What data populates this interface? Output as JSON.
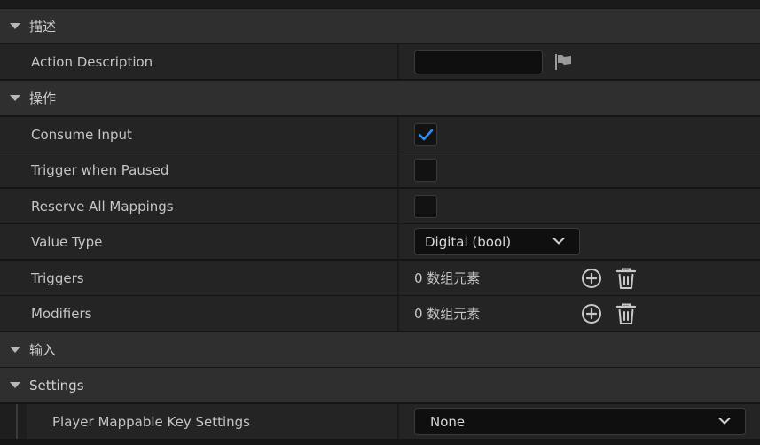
{
  "categories": {
    "description": "描述",
    "action": "操作",
    "input": "输入",
    "settings": "Settings"
  },
  "properties": {
    "action_description": {
      "label": "Action Description",
      "value": ""
    },
    "consume_input": {
      "label": "Consume Input",
      "checked": true
    },
    "trigger_when_paused": {
      "label": "Trigger when Paused",
      "checked": false
    },
    "reserve_all_mappings": {
      "label": "Reserve All Mappings",
      "checked": false
    },
    "value_type": {
      "label": "Value Type",
      "selected": "Digital (bool)"
    },
    "triggers": {
      "label": "Triggers",
      "count_text": "0 数组元素"
    },
    "modifiers": {
      "label": "Modifiers",
      "count_text": "0 数组元素"
    },
    "player_mappable_key_settings": {
      "label": "Player Mappable Key Settings",
      "selected": "None"
    }
  },
  "icons": {
    "category_toggle": "triangle-down-icon",
    "reset": "flag-icon",
    "checkbox_mark": "checkmark-icon",
    "dropdown": "chevron-down-icon",
    "add": "add-circle-icon",
    "clear": "trash-icon"
  },
  "colors": {
    "checkmark": "#2f8cf0",
    "category_bg": "#2f2f2f",
    "property_bg": "#242424",
    "input_bg": "#0f0f0f"
  }
}
